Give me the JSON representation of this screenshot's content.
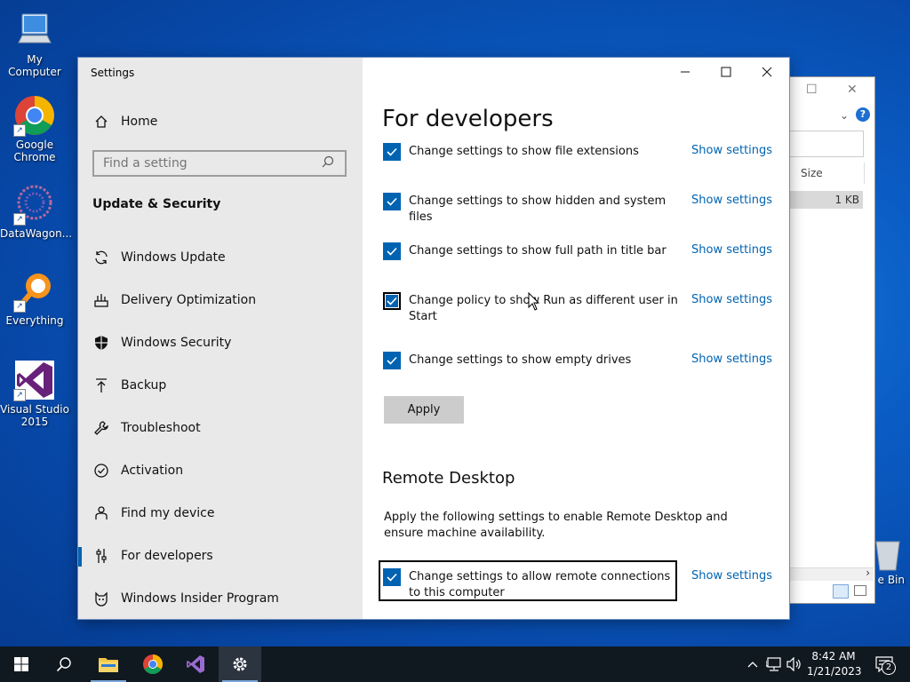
{
  "desktop": {
    "icons": [
      {
        "label": "My Computer"
      },
      {
        "label": "Google Chrome"
      },
      {
        "label": "DataWagon..."
      },
      {
        "label": "Everything"
      },
      {
        "label": "Visual Studio 2015"
      },
      {
        "label": "e Bin"
      }
    ]
  },
  "explorer": {
    "column_size": "Size",
    "row_size": "1 KB"
  },
  "settings": {
    "window_title": "Settings",
    "home": "Home",
    "search_placeholder": "Find a setting",
    "section": "Update & Security",
    "nav": [
      {
        "label": "Windows Update",
        "icon": "refresh-icon"
      },
      {
        "label": "Delivery Optimization",
        "icon": "delivery-icon"
      },
      {
        "label": "Windows Security",
        "icon": "shield-icon"
      },
      {
        "label": "Backup",
        "icon": "backup-arrow-icon"
      },
      {
        "label": "Troubleshoot",
        "icon": "wrench-icon"
      },
      {
        "label": "Activation",
        "icon": "check-circle-icon"
      },
      {
        "label": "Find my device",
        "icon": "person-pin-icon"
      },
      {
        "label": "For developers",
        "icon": "sliders-icon",
        "active": true
      },
      {
        "label": "Windows Insider Program",
        "icon": "insider-cat-icon"
      }
    ],
    "page_title": "For developers",
    "options": [
      {
        "label": "Change settings to show file extensions",
        "link": "Show settings",
        "checked": true
      },
      {
        "label": "Change settings to show hidden and system files",
        "link": "Show settings",
        "checked": true
      },
      {
        "label": "Change settings to show full path in title bar",
        "link": "Show settings",
        "checked": true
      },
      {
        "label": "Change policy to show Run as different user in Start",
        "link": "Show settings",
        "checked": true,
        "focused": true
      },
      {
        "label": "Change settings to show empty drives",
        "link": "Show settings",
        "checked": true
      }
    ],
    "apply": "Apply",
    "remote_desktop": {
      "title": "Remote Desktop",
      "description": "Apply the following settings to enable Remote Desktop and ensure machine availability.",
      "option": {
        "label": "Change settings to allow remote connections to this computer",
        "link": "Show settings",
        "checked": true
      }
    }
  },
  "taskbar": {
    "time": "8:42 AM",
    "date": "1/21/2023",
    "notification_count": "2"
  },
  "colors": {
    "accent": "#0063b1",
    "sidebar_bg": "#e9e9e9",
    "taskbar_bg": "#101820"
  }
}
